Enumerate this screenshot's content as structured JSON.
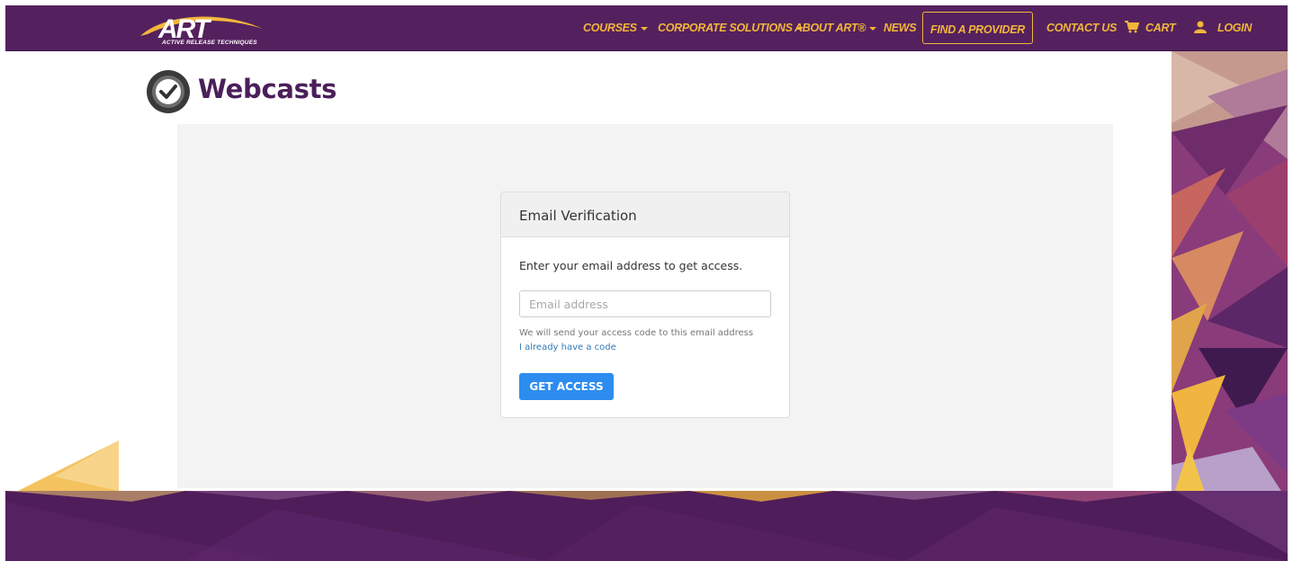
{
  "header": {
    "logo_text": "ART",
    "logo_subtitle": "ACTIVE RELEASE TECHNIQUES",
    "nav": {
      "courses": "COURSES",
      "corporate": "CORPORATE SOLUTIONS",
      "about": "ABOUT ART®",
      "news": "NEWS",
      "find_provider": "FIND A PROVIDER",
      "contact": "CONTACT US",
      "cart": "CART",
      "login": "LOGIN"
    }
  },
  "page": {
    "title": "Webcasts"
  },
  "verification": {
    "heading": "Email Verification",
    "intro": "Enter your email address to get access.",
    "email_placeholder": "Email address",
    "email_value": "",
    "help_text": "We will send your access code to this email address",
    "have_code_link": "I already have a code",
    "submit_label": "GET ACCESS"
  },
  "colors": {
    "header_bg": "#54215e",
    "nav_accent": "#f2b63a",
    "title_color": "#4b1f5a",
    "button_bg": "#2d8cf0",
    "link_color": "#337ab7"
  },
  "icons": {
    "cart": "cart-icon",
    "login": "user-icon",
    "title": "checkmark-badge-icon",
    "caret": "caret-down-icon"
  }
}
